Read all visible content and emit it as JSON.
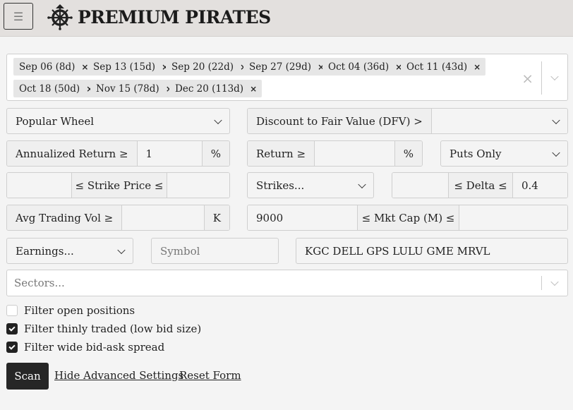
{
  "header": {
    "menu_icon": "hamburger-icon",
    "brand_icon": "ship-wheel-icon",
    "title": "PREMIUM PIRATES"
  },
  "expirations": {
    "tags": [
      {
        "label": "Sep 06 (8d)"
      },
      {
        "label": "Sep 13 (15d)"
      },
      {
        "label": "Sep 20 (22d)"
      },
      {
        "label": "Sep 27 (29d)"
      },
      {
        "label": "Oct 04 (36d)"
      },
      {
        "label": "Oct 11 (43d)"
      },
      {
        "label": "Oct 18 (50d)"
      },
      {
        "label": "Nov 15 (78d)"
      },
      {
        "label": "Dec 20 (113d)"
      }
    ],
    "remove_glyph": "×",
    "clear_glyph": "×"
  },
  "strategy": {
    "value": "Popular Wheel"
  },
  "dfv": {
    "label": "Discount to Fair Value (DFV) >",
    "value": ""
  },
  "annualized_return": {
    "label": "Annualized Return ≥",
    "value": "1",
    "suffix": "%"
  },
  "return": {
    "label": "Return ≥",
    "value": "",
    "suffix": "%"
  },
  "option_type": {
    "value": "Puts Only"
  },
  "strike_price": {
    "min": "",
    "label": "≤ Strike Price ≤",
    "max": ""
  },
  "strikes": {
    "value": "Strikes..."
  },
  "delta": {
    "min": "",
    "label": "≤ Delta ≤",
    "max": "0.4"
  },
  "avg_trading_vol": {
    "label": "Avg Trading Vol ≥",
    "value": "",
    "suffix": "K"
  },
  "mkt_cap": {
    "min": "9000",
    "label": "≤ Mkt Cap (M) ≤",
    "max": ""
  },
  "earnings": {
    "value": "Earnings..."
  },
  "symbol": {
    "placeholder": "Symbol",
    "value": ""
  },
  "exclude_symbols": {
    "value": "KGC DELL GPS LULU GME MRVL"
  },
  "sectors": {
    "placeholder": "Sectors..."
  },
  "filters": [
    {
      "label": "Filter open positions",
      "checked": false
    },
    {
      "label": "Filter thinly traded (low bid size)",
      "checked": true
    },
    {
      "label": "Filter wide bid-ask spread",
      "checked": true
    }
  ],
  "actions": {
    "scan": "Scan",
    "hide_advanced": "Hide Advanced Settings",
    "reset": "Reset Form"
  }
}
